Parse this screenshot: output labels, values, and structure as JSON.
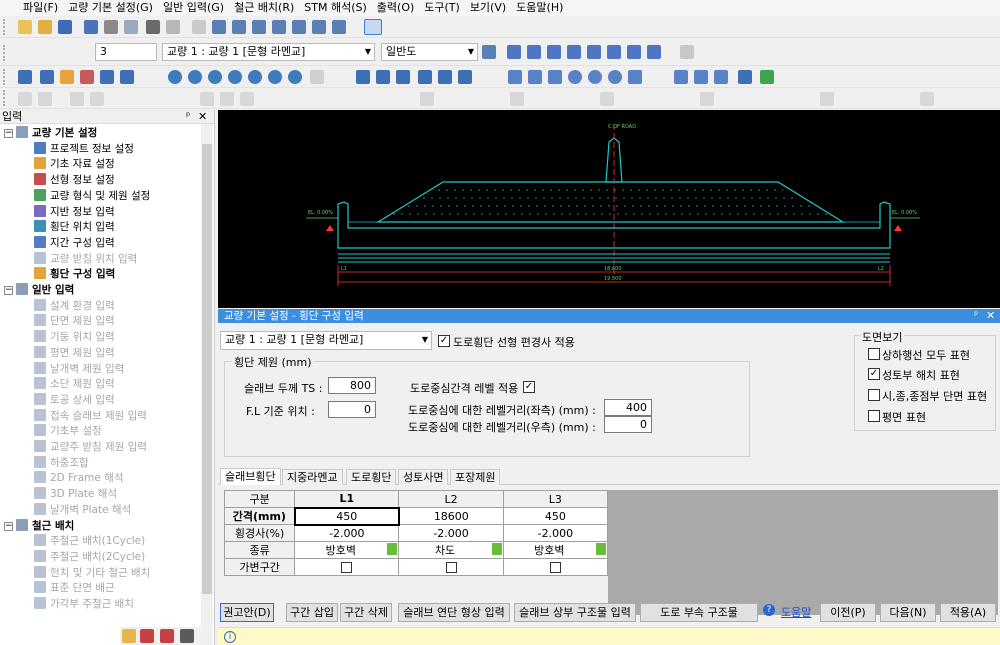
{
  "menu": [
    "파일(F)",
    "교량 기본 설정(G)",
    "일반 입력(G)",
    "철근 배치(R)",
    "STM 해석(S)",
    "출력(O)",
    "도구(T)",
    "보기(V)",
    "도움말(H)"
  ],
  "toolbar2": {
    "span_value": "3",
    "bridge_select": "교량 1 : 교량 1 [문형 라멘교]",
    "view_select": "일반도"
  },
  "left_panel": {
    "title": "입력",
    "groups": [
      {
        "label": "교량 기본 설정",
        "items": [
          {
            "label": "프로젝트 정보 설정",
            "enabled": true
          },
          {
            "label": "기초 자료 설정",
            "enabled": true
          },
          {
            "label": "선형 정보 설정",
            "enabled": true
          },
          {
            "label": "교량 형식 및 제원 설정",
            "enabled": true
          },
          {
            "label": "지반 정보 입력",
            "enabled": true
          },
          {
            "label": "횡단 위치 입력",
            "enabled": true
          },
          {
            "label": "지간 구성 입력",
            "enabled": true
          },
          {
            "label": "교량 받침 위치 입력",
            "enabled": false
          },
          {
            "label": "횡단 구성 입력",
            "enabled": true,
            "bold": true
          }
        ]
      },
      {
        "label": "일반 입력",
        "items": [
          {
            "label": "설계 환경 입력",
            "enabled": false
          },
          {
            "label": "단면 제원 입력",
            "enabled": false
          },
          {
            "label": "기둥 위치 입력",
            "enabled": false
          },
          {
            "label": "평면 제원 입력",
            "enabled": false
          },
          {
            "label": "날개벽 제원 입력",
            "enabled": false
          },
          {
            "label": "소단 제원 입력",
            "enabled": false
          },
          {
            "label": "토공 상세 입력",
            "enabled": false
          },
          {
            "label": "접속 슬래브 제원 입력",
            "enabled": false
          },
          {
            "label": "기초부 설정",
            "enabled": false
          },
          {
            "label": "교량주 받침 제원 입력",
            "enabled": false
          },
          {
            "label": "하중조합",
            "enabled": false
          },
          {
            "label": "2D Frame 해석",
            "enabled": false
          },
          {
            "label": "3D Plate 해석",
            "enabled": false
          },
          {
            "label": "날개벽 Plate 해석",
            "enabled": false
          }
        ]
      },
      {
        "label": "철근 배치",
        "items": [
          {
            "label": "주철근 배치(1Cycle)",
            "enabled": false
          },
          {
            "label": "주철근 배치(2Cycle)",
            "enabled": false
          },
          {
            "label": "헌치 및 기타 철근 배치",
            "enabled": false
          },
          {
            "label": "표준 단면 배근",
            "enabled": false
          },
          {
            "label": "가각부 주철근 배치",
            "enabled": false
          }
        ]
      }
    ]
  },
  "cad_texts": {
    "top_label": "C.OF ROAD",
    "left_slope": "EL. 0.00%",
    "right_slope": "EL. 0.00%",
    "dim1": "18,600",
    "dim2": "19,500",
    "l1": "L1",
    "l2": "L2"
  },
  "dialog": {
    "title": "교량 기본 설정 - 횡단 구성 입력",
    "bridge_select": "교량 1 : 교량 1 [문형 라멘교]",
    "apply_slope_label": "도로횡단 선형 편경사 적용",
    "section_title": "횡단 제원 (mm)",
    "slab_thickness_label": "슬래브 두께 TS :",
    "slab_thickness": "800",
    "fl_label": "F.L 기준 위치 :",
    "fl_value": "0",
    "level_label": "도로중심간격 레벨 적용",
    "left_dist_label": "도로중심에 대한 레벨거리(좌측) (mm) :",
    "left_dist": "400",
    "right_dist_label": "도로중심에 대한 레벨거리(우측) (mm) :",
    "right_dist": "0",
    "view_options": {
      "title": "도면보기",
      "items": [
        {
          "label": "상하행선 모두 표현",
          "checked": false
        },
        {
          "label": "성토부 해치 표현",
          "checked": true
        },
        {
          "label": "시,종,종점부 단면 표현",
          "checked": false
        },
        {
          "label": "평면 표현",
          "checked": false
        }
      ]
    },
    "tabs": [
      "슬래브횡단",
      "지중라멘교",
      "도로횡단",
      "성토사면",
      "포장제원"
    ],
    "grid": {
      "headers": [
        "구분",
        "L1",
        "L2",
        "L3"
      ],
      "rows": [
        {
          "label": "간격(mm)",
          "values": [
            "450",
            "18600",
            "450"
          ]
        },
        {
          "label": "횡경사(%)",
          "values": [
            "-2.000",
            "-2.000",
            "-2.000"
          ]
        },
        {
          "label": "종류",
          "values": [
            "방호벽",
            "차도",
            "방호벽"
          ]
        },
        {
          "label": "가변구간",
          "values": [
            "",
            "",
            ""
          ]
        }
      ]
    },
    "buttons": {
      "recommend": "권고안(D)",
      "insert": "구간 삽입",
      "delete": "구간 삭제",
      "slab_shape": "슬래브 연단 형상 입력",
      "slab_top": "슬래브 상부 구조물 입력",
      "road_struct": "도로 부속 구조물",
      "help": "도움말",
      "prev": "이전(P)",
      "next": "다음(N)",
      "apply": "적용(A)"
    },
    "info_icon": "info-icon"
  }
}
